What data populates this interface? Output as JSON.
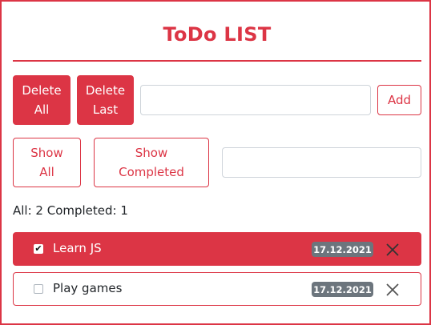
{
  "app": {
    "title": "ToDo LIST"
  },
  "toolbar": {
    "delete_all_line1": "Delete",
    "delete_all_line2": "All",
    "delete_last_line1": "Delete",
    "delete_last_line2": "Last",
    "new_todo_value": "",
    "add_label": "Add"
  },
  "filters": {
    "show_all_line1": "Show",
    "show_all_line2": "All",
    "show_completed_line1": "Show",
    "show_completed_line2": "Completed",
    "search_value": ""
  },
  "stats": {
    "text": "All: 2 Completed: 1"
  },
  "todos": [
    {
      "text": "Learn JS",
      "date": "17.12.2021",
      "completed": true,
      "check_glyph": "✔"
    },
    {
      "text": "Play games",
      "date": "17.12.2021",
      "completed": false,
      "check_glyph": ""
    }
  ],
  "colors": {
    "accent": "#dc3545",
    "badge": "#6c757d",
    "input_border": "#ced4da"
  },
  "icons": {
    "close": "close-icon",
    "check": "checkmark-icon"
  }
}
